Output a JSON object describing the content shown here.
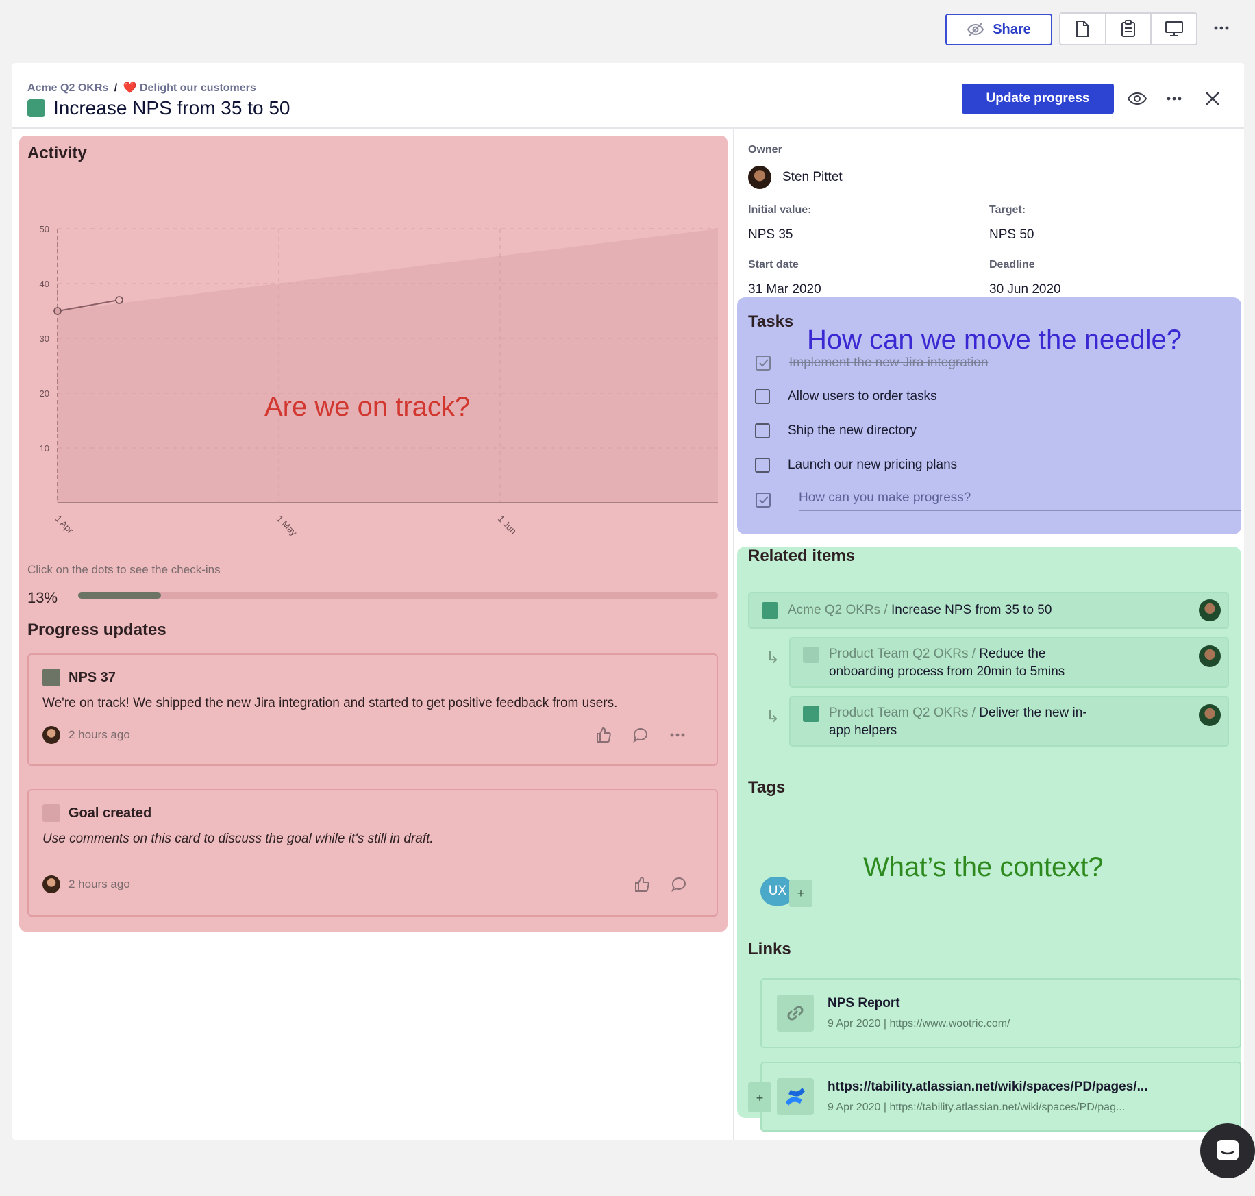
{
  "toolbar": {
    "share_label": "Share"
  },
  "header": {
    "breadcrumb_root": "Acme Q2 OKRs",
    "breadcrumb_sep": "/",
    "breadcrumb_goal": "Delight our customers",
    "title": "Increase NPS from 35 to 50",
    "update_label": "Update progress"
  },
  "activity": {
    "heading": "Activity",
    "hint": "Click on the dots to see the check-ins",
    "progress_pct_label": "13%",
    "progress_fraction": 0.13,
    "overlay": "Are we on track?"
  },
  "chart_data": {
    "type": "line",
    "ylim": [
      0,
      50
    ],
    "yticks": [
      "50",
      "40",
      "30",
      "20",
      "10"
    ],
    "xticks": [
      "1 Apr",
      "1 May",
      "1 Jun"
    ],
    "series": [
      {
        "values": [
          [
            0,
            35
          ],
          [
            1,
            37
          ]
        ]
      }
    ],
    "target_area": {
      "start": 35,
      "end": 50
    }
  },
  "updates": {
    "heading": "Progress updates",
    "items": [
      {
        "title": "NPS 37",
        "body": "We're on track! We shipped the new Jira integration and started to get positive feedback from users.",
        "time": "2 hours ago",
        "color": "#6b7465"
      },
      {
        "title": "Goal created",
        "body": "Use comments on this card to discuss the goal while it's still in draft.",
        "time": "2 hours ago",
        "color": "#d8a4a8"
      }
    ]
  },
  "details": {
    "owner_label": "Owner",
    "owner_name": "Sten Pittet",
    "initial_label": "Initial value:",
    "initial_value": "NPS 35",
    "target_label": "Target:",
    "target_value": "NPS 50",
    "start_label": "Start date",
    "start_value": "31 Mar 2020",
    "deadline_label": "Deadline",
    "deadline_value": "30 Jun 2020"
  },
  "tasks": {
    "heading": "Tasks",
    "overlay": "How can we move the needle?",
    "items": [
      {
        "label": "Implement the new Jira integration",
        "done": true
      },
      {
        "label": "Allow users to order tasks",
        "done": false
      },
      {
        "label": "Ship the new directory",
        "done": false
      },
      {
        "label": "Launch our new pricing plans",
        "done": false
      }
    ],
    "input_placeholder": "How can you make progress?"
  },
  "related": {
    "heading": "Related items",
    "items": [
      {
        "prefix": "Acme Q2 OKRs /",
        "title": "Increase NPS from 35 to 50"
      },
      {
        "prefix": "Product Team Q2 OKRs /",
        "title_line1": "Reduce the",
        "title_line2": "onboarding process from 20min to 5mins"
      },
      {
        "prefix": "Product Team Q2 OKRs /",
        "title_line1": "Deliver the new in-",
        "title_line2": "app helpers"
      }
    ]
  },
  "tags": {
    "heading": "Tags",
    "items": [
      "UX"
    ],
    "add_label": "+",
    "overlay": "What’s the context?"
  },
  "links": {
    "heading": "Links",
    "items": [
      {
        "title": "NPS Report",
        "meta": "9 Apr 2020 | https://www.wootric.com/"
      },
      {
        "title": "https://tability.atlassian.net/wiki/spaces/PD/pages/...",
        "meta": "9 Apr 2020 | https://tability.atlassian.net/wiki/spaces/PD/pag..."
      }
    ],
    "add_label": "+"
  },
  "colors": {
    "accent": "#2d44d3",
    "activity_bg": "#eebcbe",
    "tasks_bg": "#bcc1f2",
    "related_bg": "#c0efd3",
    "goal_green": "#3f9b75"
  }
}
